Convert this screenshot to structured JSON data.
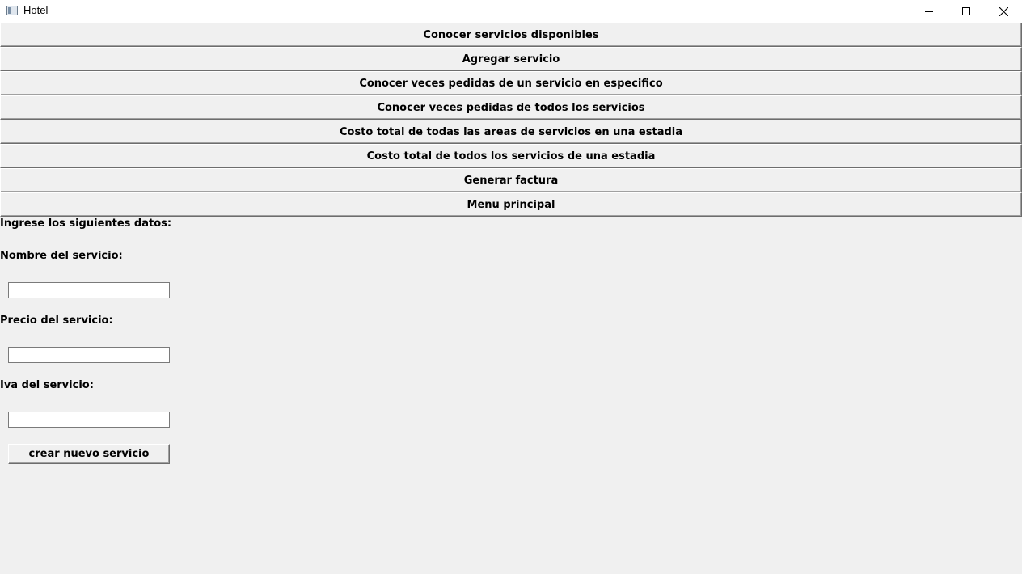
{
  "window": {
    "title": "Hotel",
    "icon": "app-window-icon",
    "controls": [
      "minimize-icon",
      "maximize-icon",
      "close-icon"
    ]
  },
  "menu": {
    "items": [
      {
        "label": "Conocer servicios disponibles"
      },
      {
        "label": "Agregar servicio"
      },
      {
        "label": "Conocer veces pedidas de un servicio en especifico"
      },
      {
        "label": "Conocer veces pedidas de todos los servicios"
      },
      {
        "label": "Costo total de todas las areas de servicios en una estadia"
      },
      {
        "label": "Costo total de todos los servicios de una estadia"
      },
      {
        "label": "Generar factura"
      },
      {
        "label": "Menu principal"
      }
    ]
  },
  "form": {
    "intro": "Ingrese los siguientes datos:",
    "name_label": "Nombre del servicio:",
    "name_value": "",
    "price_label": "Precio del servicio:",
    "price_value": "",
    "iva_label": "Iva del servicio:",
    "iva_value": "",
    "submit_label": "crear nuevo servicio"
  },
  "colors": {
    "background": "#f0f0f0",
    "titlebar": "#ffffff",
    "field_border": "#7a7a7a"
  }
}
